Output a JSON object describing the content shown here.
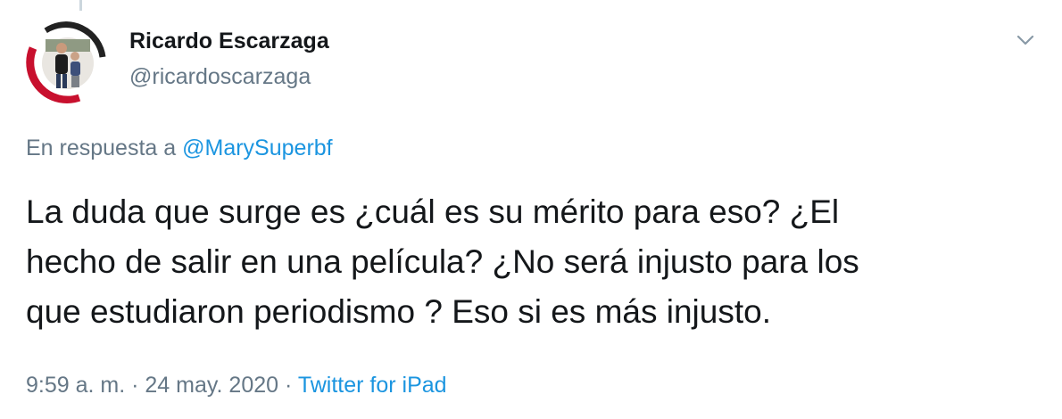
{
  "author": {
    "display_name": "Ricardo Escarzaga",
    "handle": "@ricardoscarzaga",
    "avatar": "profile-photo"
  },
  "reply": {
    "prefix": "En respuesta a",
    "mention": "@MarySuperbf"
  },
  "tweet": {
    "text": "La duda que surge es ¿cuál es su mérito para eso? ¿El\nhecho de salir en una película? ¿No será injusto para los\nque estudiaron periodismo ? Eso si es más injusto."
  },
  "meta": {
    "time": "9:59 a. m.",
    "separator": "·",
    "date": "24 may. 2020",
    "source": "Twitter for iPad"
  },
  "icons": {
    "menu": "chevron-down-icon"
  },
  "colors": {
    "text": "#14171a",
    "secondary": "#657786",
    "link": "#1b95e0",
    "thread_line": "#ccd6dd"
  }
}
